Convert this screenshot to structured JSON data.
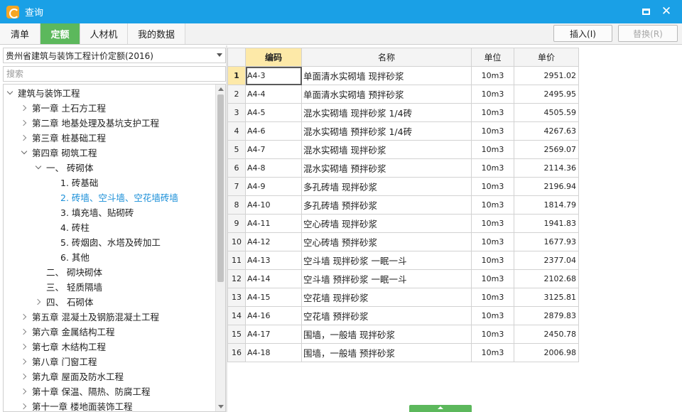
{
  "window": {
    "title": "查询"
  },
  "tabs": [
    {
      "label": "清单"
    },
    {
      "label": "定额",
      "active": true
    },
    {
      "label": "人材机"
    },
    {
      "label": "我的数据"
    }
  ],
  "toolbar": {
    "insert_label": "插入(I)",
    "replace_label": "替换(R)"
  },
  "left": {
    "dropdown_value": "贵州省建筑与装饰工程计价定额(2016)",
    "search_placeholder": "搜索",
    "tree": [
      {
        "label": "建筑与装饰工程",
        "level": 0,
        "expand": "down"
      },
      {
        "label": "第一章 土石方工程",
        "level": 1,
        "expand": "right"
      },
      {
        "label": "第二章 地基处理及基坑支护工程",
        "level": 1,
        "expand": "right"
      },
      {
        "label": "第三章 桩基础工程",
        "level": 1,
        "expand": "right"
      },
      {
        "label": "第四章 砌筑工程",
        "level": 1,
        "expand": "down"
      },
      {
        "label": "一、 砖砌体",
        "level": 2,
        "expand": "down"
      },
      {
        "label": "1. 砖基础",
        "level": 3,
        "expand": "none"
      },
      {
        "label": "2. 砖墙、空斗墙、空花墙砖墙",
        "level": 3,
        "expand": "none",
        "selected": true
      },
      {
        "label": "3. 填充墙、贴砌砖",
        "level": 3,
        "expand": "none"
      },
      {
        "label": "4. 砖柱",
        "level": 3,
        "expand": "none"
      },
      {
        "label": "5. 砖烟囱、水塔及砖加工",
        "level": 3,
        "expand": "none"
      },
      {
        "label": "6. 其他",
        "level": 3,
        "expand": "none"
      },
      {
        "label": "二、 砌块砌体",
        "level": 2,
        "expand": "none"
      },
      {
        "label": "三、 轻质隔墙",
        "level": 2,
        "expand": "none"
      },
      {
        "label": "四、 石砌体",
        "level": 2,
        "expand": "right"
      },
      {
        "label": "第五章 混凝土及钢筋混凝土工程",
        "level": 1,
        "expand": "right"
      },
      {
        "label": "第六章 金属结构工程",
        "level": 1,
        "expand": "right"
      },
      {
        "label": "第七章 木结构工程",
        "level": 1,
        "expand": "right"
      },
      {
        "label": "第八章 门窗工程",
        "level": 1,
        "expand": "right"
      },
      {
        "label": "第九章 屋面及防水工程",
        "level": 1,
        "expand": "right"
      },
      {
        "label": "第十章 保温、隔热、防腐工程",
        "level": 1,
        "expand": "right"
      },
      {
        "label": "第十一章 楼地面装饰工程",
        "level": 1,
        "expand": "right"
      }
    ]
  },
  "grid": {
    "headers": {
      "code": "编码",
      "name": "名称",
      "unit": "单位",
      "price": "单价"
    },
    "rows": [
      {
        "idx": "1",
        "code": "A4-3",
        "name": "单面清水实砌墙 现拌砂浆",
        "unit": "10m3",
        "price": "2951.02"
      },
      {
        "idx": "2",
        "code": "A4-4",
        "name": "单面清水实砌墙 预拌砂浆",
        "unit": "10m3",
        "price": "2495.95"
      },
      {
        "idx": "3",
        "code": "A4-5",
        "name": "混水实砌墙 现拌砂浆 1/4砖",
        "unit": "10m3",
        "price": "4505.59"
      },
      {
        "idx": "4",
        "code": "A4-6",
        "name": "混水实砌墙 预拌砂浆 1/4砖",
        "unit": "10m3",
        "price": "4267.63"
      },
      {
        "idx": "5",
        "code": "A4-7",
        "name": "混水实砌墙 现拌砂浆",
        "unit": "10m3",
        "price": "2569.07"
      },
      {
        "idx": "6",
        "code": "A4-8",
        "name": "混水实砌墙 预拌砂浆",
        "unit": "10m3",
        "price": "2114.36"
      },
      {
        "idx": "7",
        "code": "A4-9",
        "name": "多孔砖墙 现拌砂浆",
        "unit": "10m3",
        "price": "2196.94"
      },
      {
        "idx": "8",
        "code": "A4-10",
        "name": "多孔砖墙 预拌砂浆",
        "unit": "10m3",
        "price": "1814.79"
      },
      {
        "idx": "9",
        "code": "A4-11",
        "name": "空心砖墙 现拌砂浆",
        "unit": "10m3",
        "price": "1941.83"
      },
      {
        "idx": "10",
        "code": "A4-12",
        "name": "空心砖墙 预拌砂浆",
        "unit": "10m3",
        "price": "1677.93"
      },
      {
        "idx": "11",
        "code": "A4-13",
        "name": "空斗墙 现拌砂浆 一眠一斗",
        "unit": "10m3",
        "price": "2377.04"
      },
      {
        "idx": "12",
        "code": "A4-14",
        "name": "空斗墙 预拌砂浆 一眠一斗",
        "unit": "10m3",
        "price": "2102.68"
      },
      {
        "idx": "13",
        "code": "A4-15",
        "name": "空花墙 现拌砂浆",
        "unit": "10m3",
        "price": "3125.81"
      },
      {
        "idx": "14",
        "code": "A4-16",
        "name": "空花墙 预拌砂浆",
        "unit": "10m3",
        "price": "2879.83"
      },
      {
        "idx": "15",
        "code": "A4-17",
        "name": "围墙，一般墙 现拌砂浆",
        "unit": "10m3",
        "price": "2450.78"
      },
      {
        "idx": "16",
        "code": "A4-18",
        "name": "围墙，一般墙 预拌砂浆",
        "unit": "10m3",
        "price": "2006.98"
      }
    ]
  },
  "colors": {
    "titlebar": "#1aa0e6",
    "active_tab": "#5cb85c",
    "selected_text": "#1a8fd8",
    "highlight": "#fde9a8"
  }
}
